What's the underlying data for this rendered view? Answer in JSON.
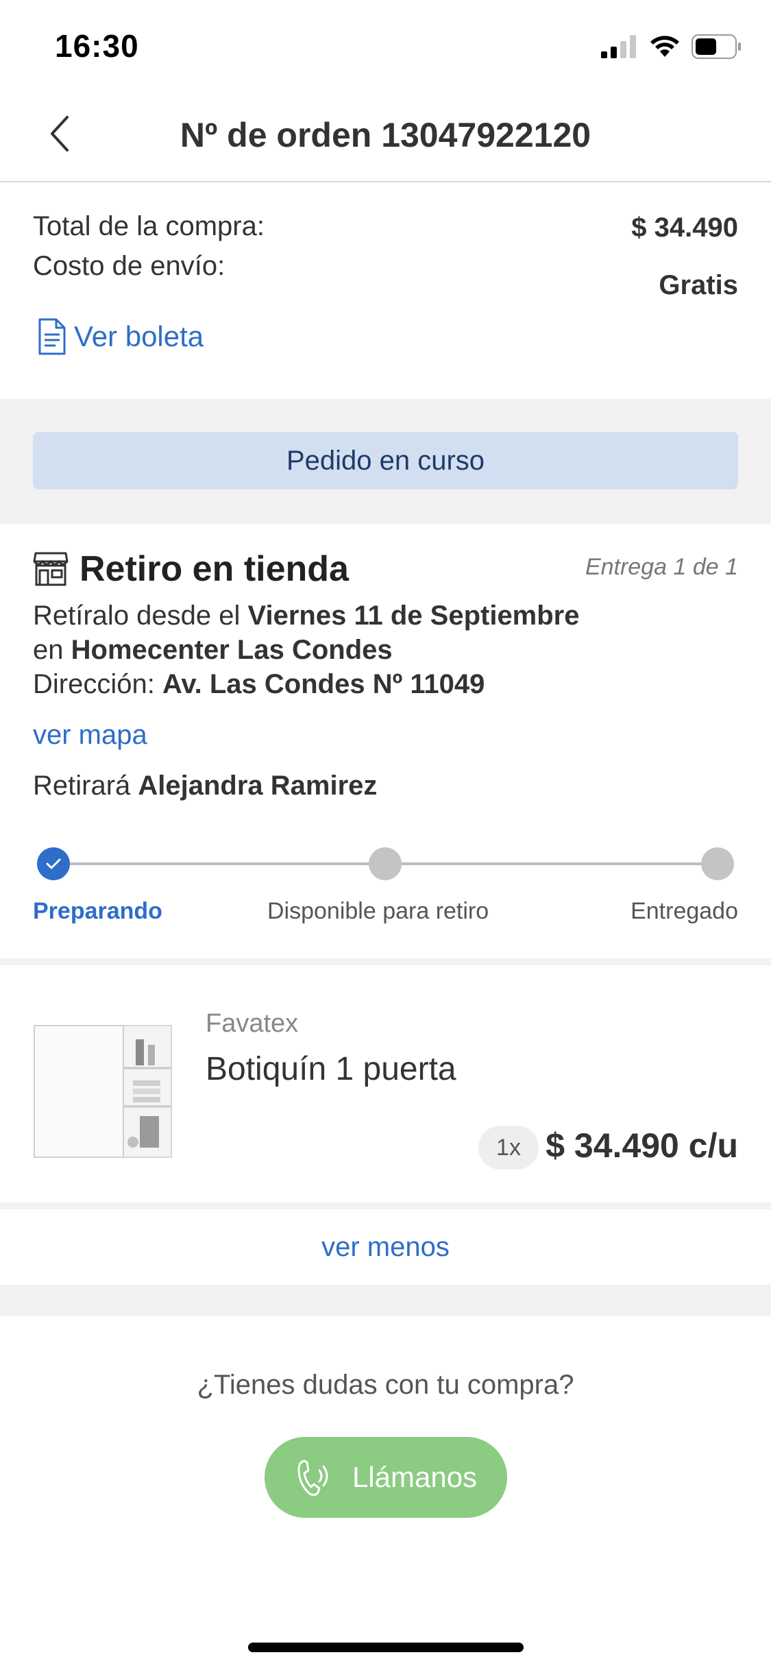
{
  "status_bar": {
    "time": "16:30"
  },
  "header": {
    "title": "Nº de orden 13047922120"
  },
  "summary": {
    "total_label": "Total de la compra:",
    "total_value": "$ 34.490",
    "shipping_label": "Costo de envío:",
    "shipping_value": "Gratis",
    "receipt_link": "Ver boleta"
  },
  "order_status": "Pedido en curso",
  "pickup": {
    "title": "Retiro en tienda",
    "delivery_count": "Entrega  1 de 1",
    "line1_prefix": "Retíralo desde el",
    "line1_date": "Viernes 11 de Septiembre",
    "line2_prefix": "en",
    "line2_store": "Homecenter Las Condes",
    "line3_prefix": "Dirección:",
    "line3_address": "Av. Las Condes Nº 11049",
    "map_link": "ver mapa",
    "picker_prefix": "Retirará",
    "picker_name": "Alejandra Ramirez",
    "steps": [
      {
        "label": "Preparando",
        "active": true
      },
      {
        "label": "Disponible para retiro",
        "active": false
      },
      {
        "label": "Entregado",
        "active": false
      }
    ]
  },
  "product": {
    "brand": "Favatex",
    "name": "Botiquín  1 puerta",
    "quantity": "1x",
    "unit_price": "$ 34.490 c/u"
  },
  "toggle_details": "ver menos",
  "help": {
    "question": "¿Tienes dudas con tu compra?",
    "call_button": "Llámanos"
  },
  "colors": {
    "accent_blue": "#2e6dc9",
    "status_pill_bg": "#d2dff0",
    "call_button_green": "#8bcb82"
  }
}
